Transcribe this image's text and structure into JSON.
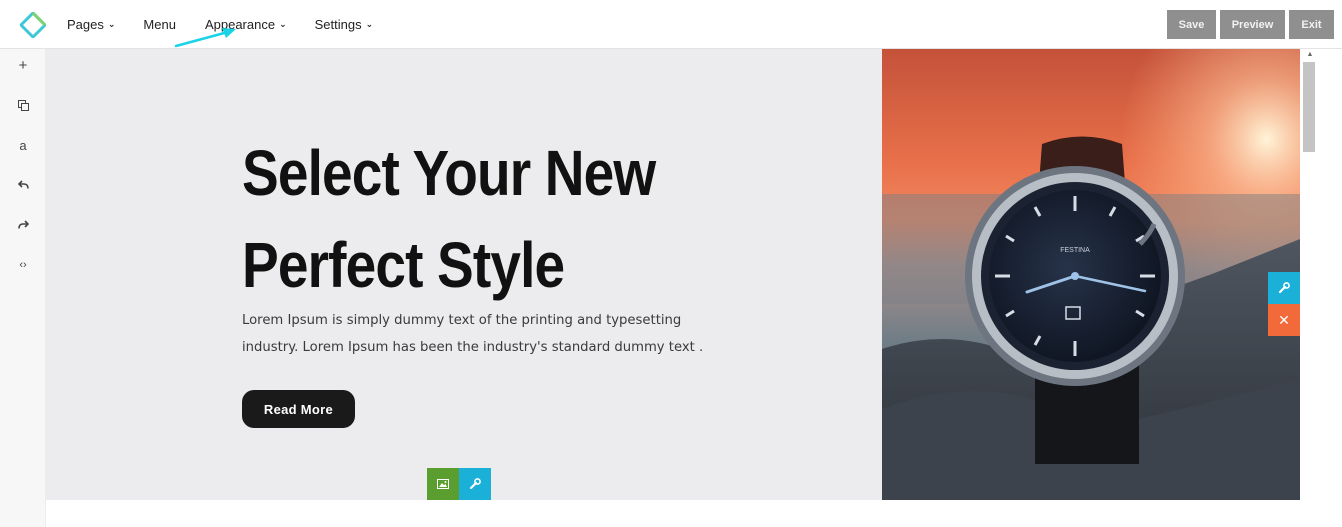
{
  "topbar": {
    "nav": [
      {
        "label": "Pages",
        "has_dropdown": true
      },
      {
        "label": "Menu",
        "has_dropdown": false
      },
      {
        "label": "Appearance",
        "has_dropdown": true
      },
      {
        "label": "Settings",
        "has_dropdown": true
      }
    ],
    "buttons": {
      "save": "Save",
      "preview": "Preview",
      "exit": "Exit"
    },
    "logo_icon": "diamond-logo-icon"
  },
  "leftbar": {
    "tools": [
      {
        "icon": "plus-icon",
        "glyph": "+"
      },
      {
        "icon": "copy-icon",
        "glyph": "⧉"
      },
      {
        "icon": "text-icon",
        "glyph": "a"
      },
      {
        "icon": "undo-icon",
        "glyph": "↶"
      },
      {
        "icon": "redo-icon",
        "glyph": "↷"
      },
      {
        "icon": "code-icon",
        "glyph": "‹›"
      }
    ]
  },
  "hero": {
    "title_line1": "Select Your New",
    "title_line2": "Perfect Style",
    "text_line1": "Lorem Ipsum is simply dummy text of the printing and typesetting",
    "text_line2": "industry. Lorem Ipsum has been the industry's standard dummy text .",
    "button": "Read More",
    "tools": [
      "image-icon",
      "wrench-icon"
    ]
  },
  "image_panel": {
    "watch_brand": "FESTINA",
    "tools": [
      "wrench-icon",
      "close-icon"
    ]
  },
  "colors": {
    "accent_blue": "#1ab0d8",
    "accent_green": "#5a9e2f",
    "accent_orange": "#f26a3a",
    "button_gray": "#8f8f8f",
    "annotation_arrow": "#19d3e6"
  }
}
